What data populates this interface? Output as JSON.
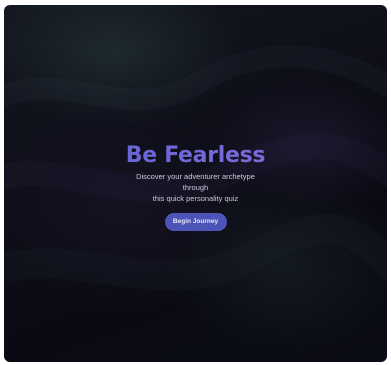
{
  "hero": {
    "title": "Be Fearless",
    "subtitle_lines": [
      "Discover your adventurer archetype",
      "through",
      "this quick personality quiz"
    ],
    "cta_label": "Begin Journey"
  },
  "colors": {
    "background": "#0b0d16",
    "title_gradient_start": "#5a63d6",
    "title_gradient_end": "#8a6fd6",
    "button": "#4e53b8",
    "subtitle_text": "#c9cadb"
  }
}
